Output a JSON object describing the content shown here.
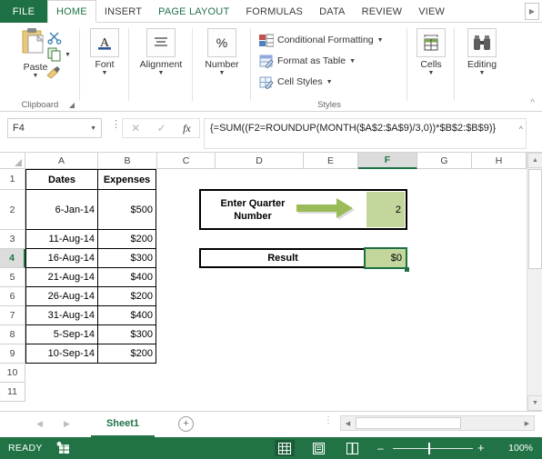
{
  "ribbon": {
    "file_tab": "FILE",
    "tabs": [
      {
        "label": "HOME",
        "state": "active"
      },
      {
        "label": "INSERT",
        "state": "normal"
      },
      {
        "label": "PAGE LAYOUT",
        "state": "highlight"
      },
      {
        "label": "FORMULAS",
        "state": "normal"
      },
      {
        "label": "DATA",
        "state": "normal"
      },
      {
        "label": "REVIEW",
        "state": "normal"
      },
      {
        "label": "VIEW",
        "state": "normal"
      }
    ],
    "tab_scroll_icon": "chevron-right-icon",
    "collapse_icon": "chevron-up-icon",
    "groups": {
      "clipboard": {
        "label": "Clipboard",
        "paste_label": "Paste",
        "paste_icon": "clipboard-icon",
        "cut_icon": "scissors-icon",
        "copy_icon": "copy-icon",
        "format_painter_icon": "paintbrush-icon",
        "dialog_launcher_icon": "dialog-launcher-icon"
      },
      "font": {
        "label": "Font",
        "icon": "font-A-icon"
      },
      "alignment": {
        "label": "Alignment",
        "icon": "align-lines-icon"
      },
      "number": {
        "label": "Number",
        "icon": "percent-icon"
      },
      "styles": {
        "label": "Styles",
        "items": [
          {
            "label": "Conditional Formatting",
            "icon": "conditional-formatting-icon"
          },
          {
            "label": "Format as Table",
            "icon": "format-as-table-icon"
          },
          {
            "label": "Cell Styles",
            "icon": "cell-styles-icon"
          }
        ]
      },
      "cells": {
        "label": "Cells",
        "icon": "cells-table-icon"
      },
      "editing": {
        "label": "Editing",
        "icon": "binoculars-icon"
      }
    }
  },
  "formula_bar": {
    "name_box_value": "F4",
    "name_box_caret_icon": "chevron-down-icon",
    "cancel_icon": "cancel-x-icon",
    "enter_icon": "enter-check-icon",
    "function_icon": "fx-icon",
    "formula": "{=SUM((F2=ROUNDUP(MONTH($A$2:$A$9)/3,0))*$B$2:$B$9)}",
    "expand_icon": "chevron-up-icon"
  },
  "grid": {
    "columns": [
      "A",
      "B",
      "C",
      "D",
      "E",
      "F",
      "G",
      "H"
    ],
    "selected_column": "F",
    "rows": [
      "1",
      "2",
      "3",
      "4",
      "5",
      "6",
      "7",
      "8",
      "9",
      "10",
      "11"
    ],
    "selected_row": "4",
    "table": {
      "headers": [
        "Dates",
        "Expenses"
      ],
      "rows": [
        {
          "date": "6-Jan-14",
          "expense": "$500"
        },
        {
          "date": "11-Aug-14",
          "expense": "$200"
        },
        {
          "date": "16-Aug-14",
          "expense": "$300"
        },
        {
          "date": "21-Aug-14",
          "expense": "$400"
        },
        {
          "date": "26-Aug-14",
          "expense": "$200"
        },
        {
          "date": "31-Aug-14",
          "expense": "$400"
        },
        {
          "date": "5-Sep-14",
          "expense": "$300"
        },
        {
          "date": "10-Sep-14",
          "expense": "$200"
        }
      ]
    },
    "quarter_box": {
      "label": "Enter Quarter Number",
      "value": "2",
      "arrow_icon": "right-arrow-icon",
      "fill_color": "#c3d69b",
      "arrow_color": "#9bbb59"
    },
    "result_box": {
      "label": "Result",
      "value": "$0",
      "fill_color": "#c3d69b",
      "selection_color": "#1e7145"
    }
  },
  "scrollbars": {
    "v_up_icon": "triangle-up-icon",
    "v_down_icon": "triangle-down-icon",
    "h_left_icon": "triangle-left-icon",
    "h_right_icon": "triangle-right-icon"
  },
  "sheet_tabs": {
    "prev_icon": "triangle-left-icon",
    "next_icon": "triangle-right-icon",
    "tabs": [
      {
        "label": "Sheet1",
        "active": true
      }
    ],
    "add_sheet_icon": "plus-circle-icon"
  },
  "status_bar": {
    "mode": "READY",
    "macro_icon": "record-macro-icon",
    "views": [
      {
        "name": "normal-view",
        "icon": "grid-icon",
        "active": true
      },
      {
        "name": "page-layout-view",
        "icon": "page-icon",
        "active": false
      },
      {
        "name": "page-break-view",
        "icon": "page-break-icon",
        "active": false
      }
    ],
    "zoom_out_label": "–",
    "zoom_in_label": "+",
    "zoom_level": "100%",
    "accent_color": "#217346"
  }
}
